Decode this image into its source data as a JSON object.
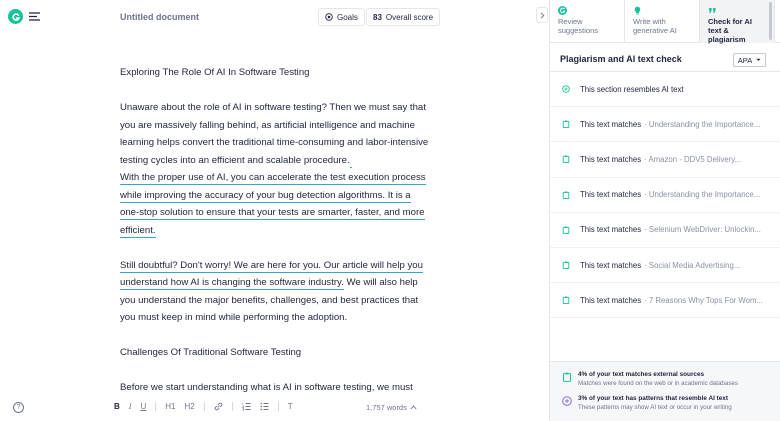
{
  "document": {
    "title": "Untitled document",
    "goals_label": "Goals",
    "score_value": "83",
    "score_label": "Overall score",
    "paragraphs": {
      "p1": "Exploring The Role Of AI In Software Testing",
      "p2a_l1": "Unaware about the role of AI in software testing? Then we must say that",
      "p2a_l2": "you are massively falling behind, as artificial intelligence and machine",
      "p2a_l3": "learning helps convert the traditional time-consuming and labor-intensive",
      "p2a_l4": "testing cycles into an efficient and scalable procedure.",
      "p2b_l1": "With the proper use of AI, you can accelerate the test execution process",
      "p2b_l2": "while improving the accuracy of your bug detection algorithms. It is a",
      "p2b_l3": "one-stop solution to ensure that your tests are smarter, faster, and more",
      "p2b_l4": "efficient.",
      "p3_l1": "Still doubtful? Don't worry! We are here for you. Our article will help you",
      "p3_l2": "understand how AI is changing the software industry.",
      "p3_l2b": " We will also help",
      "p3_l3": "you understand the major benefits, challenges, and best practices that",
      "p3_l4": "you must keep in mind while performing the adoption.",
      "p4": "Challenges Of Traditional Software Testing",
      "p5": "Before we start understanding what is AI in software testing, we must"
    },
    "word_count": "1,757 words"
  },
  "toolbar": {
    "bold": "B",
    "italic": "I",
    "underline": "U",
    "h1": "H1",
    "h2": "H2",
    "clear": "T"
  },
  "panel": {
    "tabs": [
      {
        "label": "Review suggestions"
      },
      {
        "label": "Write with generative AI"
      },
      {
        "label": "Check for AI text & plagiarism"
      }
    ],
    "heading": "Plagiarism and AI text check",
    "citation_style": "APA",
    "results": [
      {
        "main": "This section resembles AI text",
        "source": ""
      },
      {
        "main": "This text matches",
        "source": "· Understanding the Importance..."
      },
      {
        "main": "This text matches",
        "source": "· Amazon - DDV5 Delivery..."
      },
      {
        "main": "This text matches",
        "source": "· Understanding the Importance..."
      },
      {
        "main": "This text matches",
        "source": "· Selenium WebDriver: Unlockin..."
      },
      {
        "main": "This text matches",
        "source": "· Social Media Advertising..."
      },
      {
        "main": "This text matches",
        "source": "· 7 Reasons Why Tops For Wom..."
      }
    ],
    "footer": {
      "line1_title": "4% of your text matches external sources",
      "line1_desc": "Matches were found on the web or in academic databases",
      "line2_title": "3% of your text has patterns that resemble AI text",
      "line2_desc": "These patterns may show AI text or occur in your writing"
    }
  },
  "colors": {
    "brand": "#15c39a",
    "underline": "#35a5c9",
    "ai_icon": "#8a6ce0"
  }
}
